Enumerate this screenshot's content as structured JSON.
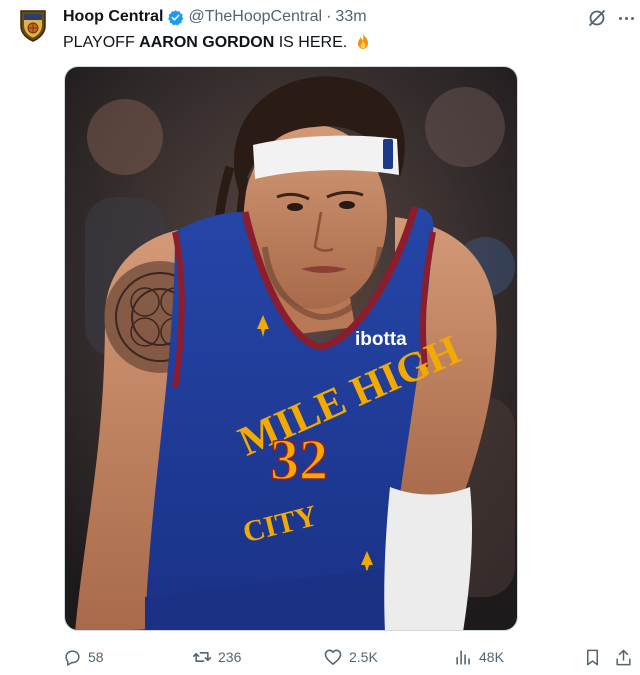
{
  "tweet": {
    "display_name": "Hoop Central",
    "handle": "@TheHoopCentral",
    "separator": "·",
    "time": "33m",
    "text_prefix": "PLAYOFF ",
    "text_bold": "AARON GORDON",
    "text_suffix": " IS HERE.",
    "text_emoji_icon": "fire-icon",
    "image": {
      "jersey_wordmark": "MILE HIGH",
      "jersey_city": "CITY",
      "jersey_number": "32",
      "sponsor_patch": "ibotta"
    }
  },
  "actions": {
    "replies": "58",
    "reposts": "236",
    "likes": "2.5K",
    "views": "48K"
  },
  "icons": {
    "grok": "grok-icon",
    "more": "more-icon",
    "reply": "reply-icon",
    "repost": "repost-icon",
    "like": "heart-icon",
    "views": "views-icon",
    "bookmark": "bookmark-icon",
    "share": "share-icon"
  },
  "colors": {
    "text": "#0f1419",
    "secondary": "#536471",
    "verified": "#1d9bf0",
    "jersey_blue": "#1f3b96",
    "jersey_gold": "#f2a900",
    "jersey_red": "#8b1d2c"
  }
}
